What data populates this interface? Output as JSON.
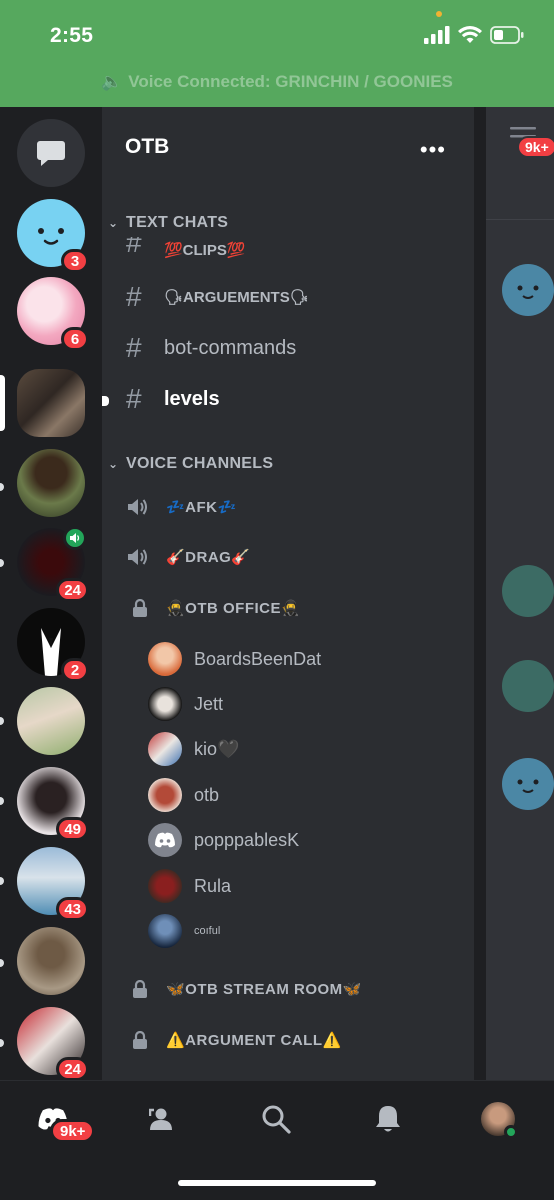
{
  "status_bar": {
    "time": "2:55"
  },
  "voice_banner": {
    "text": "Voice Connected: GRINCHIN / GOONIES"
  },
  "server_rail": {
    "servers": [
      {
        "name": "server-blue-face",
        "badge": "3"
      },
      {
        "name": "server-anime",
        "badge": "6"
      },
      {
        "name": "server-otb",
        "badge": ""
      },
      {
        "name": "server-portrait",
        "badge": ""
      },
      {
        "name": "server-red",
        "badge": "24"
      },
      {
        "name": "server-suit",
        "badge": "2"
      },
      {
        "name": "server-lover",
        "badge": ""
      },
      {
        "name": "server-person",
        "badge": "49"
      },
      {
        "name": "server-beach",
        "badge": "43"
      },
      {
        "name": "server-dance",
        "badge": ""
      },
      {
        "name": "server-sports",
        "badge": "24"
      }
    ]
  },
  "guild": {
    "name": "OTB",
    "more": "•••"
  },
  "categories": {
    "text": "TEXT CHATS",
    "voice": "VOICE CHANNELS"
  },
  "text_channels": {
    "clips": "💯CLIPS💯",
    "arguments": "🗣ARGUEMENTS🗣",
    "bot_commands": "bot-commands",
    "levels": "levels"
  },
  "voice_channels": {
    "afk": "💤AFK💤",
    "drag": "🎸DRAG🎸",
    "office": "🥷OTB OFFICE🥷",
    "stream": "🦋OTB STREAM ROOM🦋",
    "argument_call": "⚠️ARGUMENT CALL⚠️"
  },
  "members": [
    "BoardsBeenDat",
    "Jett",
    "kio🖤",
    "otb",
    "popppablesK",
    "Rula",
    "coıful"
  ],
  "peek": {
    "badge": "9k+"
  },
  "tabbar": {
    "home_badge": "9k+"
  },
  "colors": {
    "status_green": "#56a85e",
    "badge_red": "#f23f43",
    "blurple": "#5865f2",
    "online_green": "#23a55a"
  }
}
